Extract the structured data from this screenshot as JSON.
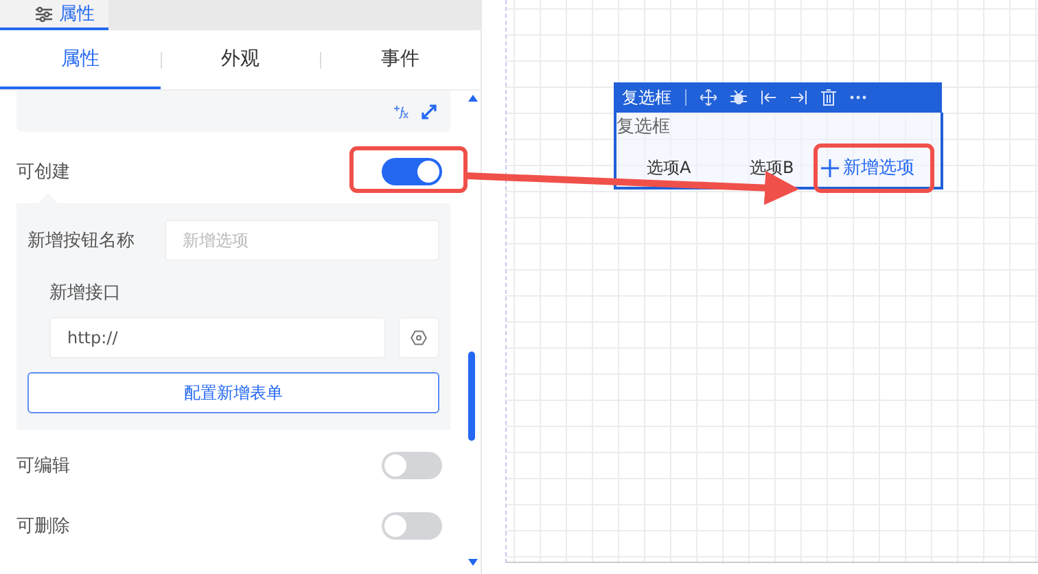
{
  "header_tab": {
    "label": "属性",
    "selected": true
  },
  "tabs": [
    {
      "label": "属性",
      "selected": true
    },
    {
      "label": "外观",
      "selected": false
    },
    {
      "label": "事件",
      "selected": false
    }
  ],
  "creatable": {
    "label": "可创建",
    "on": true
  },
  "create_settings": {
    "button_name": {
      "label": "新增按钮名称",
      "placeholder": "新增选项"
    },
    "api": {
      "label": "新增接口",
      "value": "http://"
    },
    "config_button": "配置新增表单"
  },
  "switches": [
    {
      "label": "可编辑",
      "on": false
    },
    {
      "label": "可删除",
      "on": false
    }
  ],
  "canvas": {
    "toolbar_title": "复选框",
    "component_label": "复选框",
    "options": [
      "选项A",
      "选项B"
    ],
    "add_option": "新增选项"
  }
}
